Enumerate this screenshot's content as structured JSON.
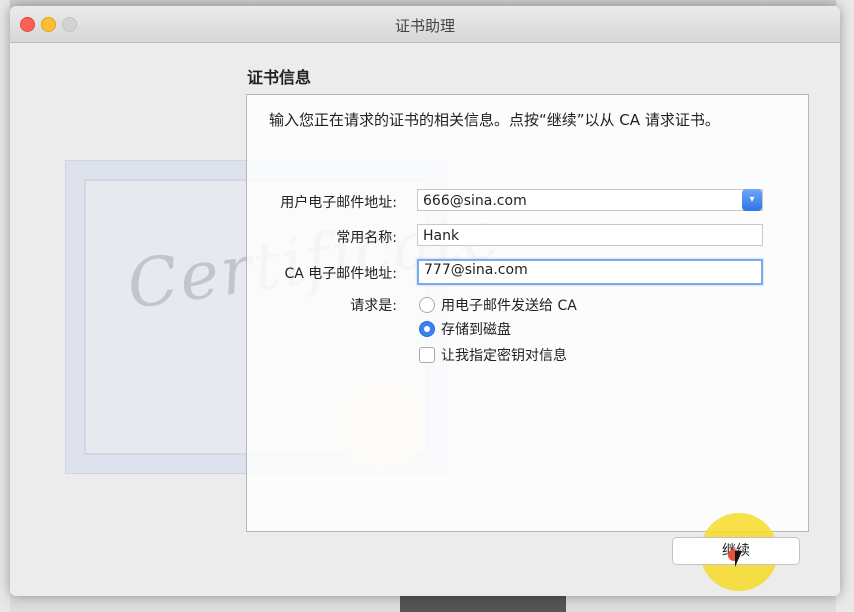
{
  "window": {
    "title": "证书助理"
  },
  "section": {
    "title": "证书信息"
  },
  "intro": "输入您正在请求的证书的相关信息。点按“继续”以从 CA 请求证书。",
  "watermark": {
    "text": "Certificate"
  },
  "form": {
    "user_email": {
      "label": "用户电子邮件地址:",
      "value": "666@sina.com"
    },
    "common_name": {
      "label": "常用名称:",
      "value": "Hank"
    },
    "ca_email": {
      "label": "CA 电子邮件地址:",
      "value": "777@sina.com"
    },
    "request": {
      "label": "请求是:",
      "options": [
        {
          "label": "用电子邮件发送给 CA",
          "selected": false
        },
        {
          "label": "存储到磁盘",
          "selected": true
        }
      ],
      "checkbox": {
        "label": "让我指定密钥对信息",
        "checked": false
      }
    }
  },
  "buttons": {
    "continue": "继续"
  },
  "colors": {
    "accent": "#3b82f0",
    "highlight": "#f6da28"
  }
}
